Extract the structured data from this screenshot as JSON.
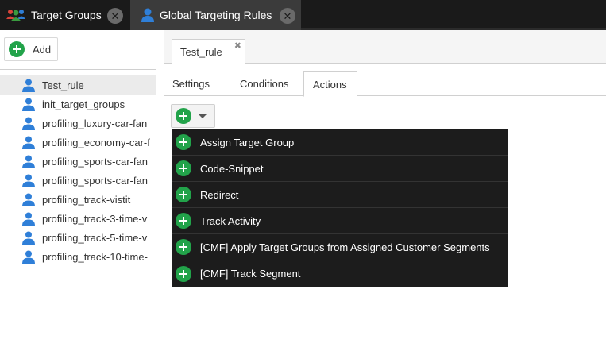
{
  "top_tabs": [
    {
      "label": "Target Groups",
      "icon": "users-group-icon"
    },
    {
      "label": "Global Targeting Rules",
      "icon": "user-icon"
    }
  ],
  "left": {
    "add_label": "Add",
    "items": [
      "Test_rule",
      "init_target_groups",
      "profiling_luxury-car-fan",
      "profiling_economy-car-f",
      "profiling_sports-car-fan",
      "profiling_sports-car-fan",
      "profiling_track-vistit",
      "profiling_track-3-time-v",
      "profiling_track-5-time-v",
      "profiling_track-10-time-"
    ]
  },
  "editor": {
    "tab_label": "Test_rule",
    "subtabs": [
      "Settings",
      "Conditions",
      "Actions"
    ],
    "active_subtab": "Actions",
    "menu_items": [
      "Assign Target Group",
      "Code-Snippet",
      "Redirect",
      "Track Activity",
      "[CMF] Apply Target Groups from Assigned Customer Segments",
      "[CMF] Track Segment"
    ]
  },
  "colors": {
    "topbar": "#1a1a1a",
    "active_tab": "#3b3b3b",
    "accent_green": "#22a34a",
    "user_icon_blue": "#2f7fd8",
    "menu_bg": "#1c1c1c"
  }
}
